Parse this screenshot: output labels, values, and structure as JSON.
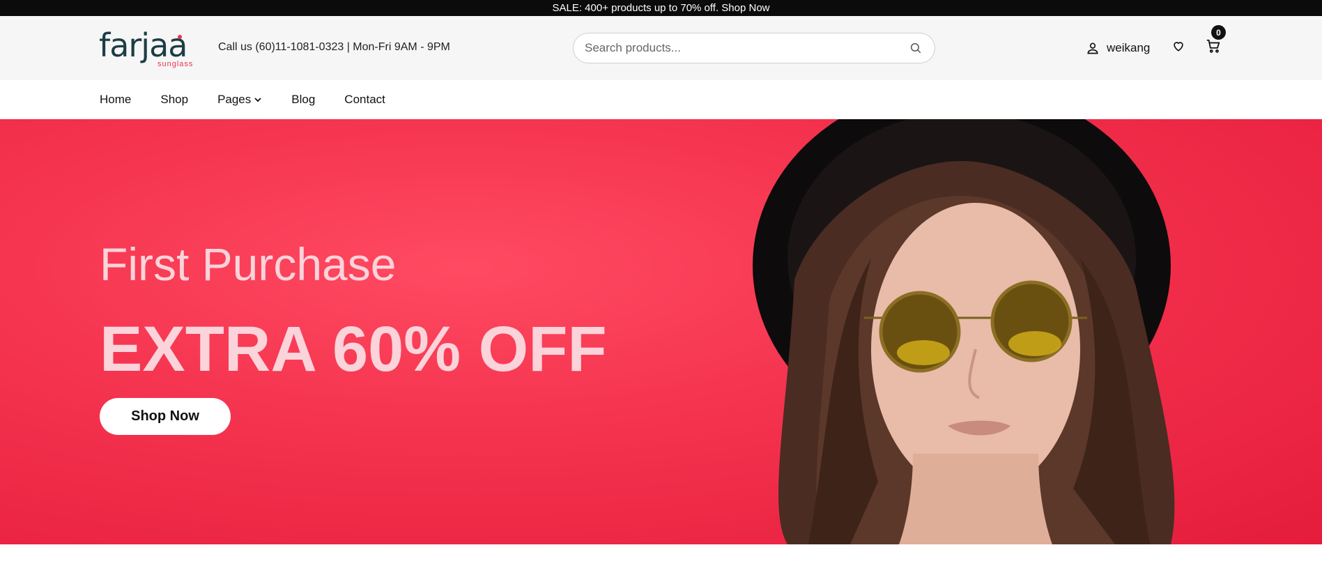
{
  "announcement": "SALE: 400+ products up to 70% off. Shop Now",
  "header": {
    "logo_text": "farjaa",
    "logo_sub": "sunglass",
    "contact": "Call us (60)11-1081-0323 | Mon-Fri 9AM - 9PM",
    "search_placeholder": "Search products...",
    "search_value": "",
    "username": "weikang",
    "cart_count": "0"
  },
  "nav": {
    "items": [
      {
        "label": "Home"
      },
      {
        "label": "Shop"
      },
      {
        "label": "Pages"
      },
      {
        "label": "Blog"
      },
      {
        "label": "Contact"
      }
    ]
  },
  "hero": {
    "subtitle": "First Purchase",
    "title": "EXTRA 60% OFF",
    "cta": "Shop Now"
  },
  "icons": {
    "search": "search-icon",
    "user": "user-icon",
    "wishlist": "heart-icon",
    "cart": "cart-icon",
    "dropdown": "chevron-down-icon"
  },
  "colors": {
    "topbar": "#0b0b0b",
    "header_bg": "#f6f6f6",
    "hero_bg": "#f5344f",
    "hero_text": "#fbd3da",
    "logo": "#1c3d45",
    "logo_accent": "#e8354f"
  }
}
